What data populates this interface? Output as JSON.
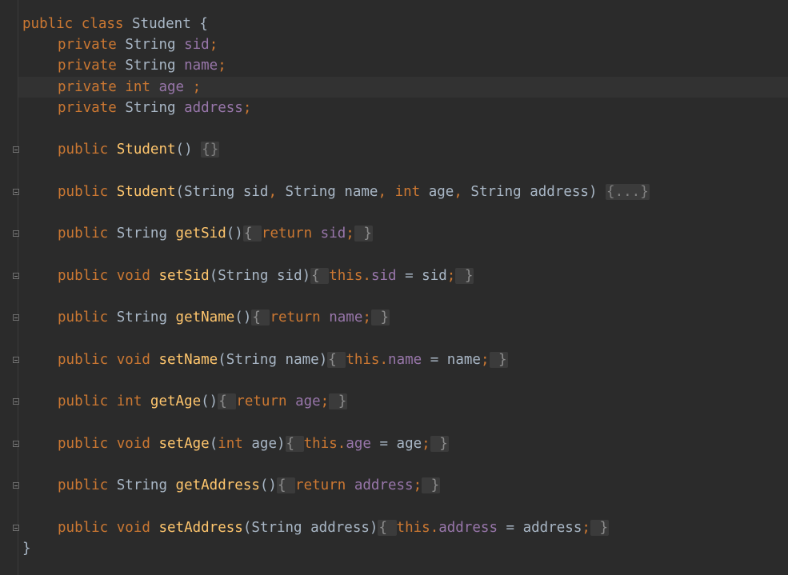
{
  "editor": {
    "lines": {
      "class_decl": {
        "kw_public": "public",
        "kw_class": "class",
        "name": "Student",
        "brace": "{"
      },
      "f_sid": {
        "kw": "private",
        "type": "String",
        "name": "sid",
        "semi": ";"
      },
      "f_name": {
        "kw": "private",
        "type": "String",
        "name": "name",
        "semi": ";"
      },
      "f_age": {
        "kw": "private",
        "type": "int",
        "name": "age",
        "semi": " ;"
      },
      "f_address": {
        "kw": "private",
        "type": "String",
        "name": "address",
        "semi": ";"
      },
      "ctor_default": {
        "kw": "public",
        "name": "Student",
        "parens": "()",
        "fold": "{}"
      },
      "ctor_full": {
        "kw": "public",
        "name": "Student",
        "open": "(",
        "t1": "String",
        "p1": "sid",
        "c1": ",",
        "t2": "String",
        "p2": "name",
        "c2": ",",
        "t3": "int",
        "p3": "age",
        "c3": ",",
        "t4": "String",
        "p4": "address",
        "close": ")",
        "fold": "{...}"
      },
      "get_sid": {
        "kw": "public",
        "type": "String",
        "name": "getSid",
        "parens": "()",
        "ob": "{ ",
        "ret": "return",
        "val": "sid",
        "semi": ";",
        "cb": " }"
      },
      "set_sid": {
        "kw": "public",
        "void": "void",
        "name": "setSid",
        "open": "(",
        "ptype": "String",
        "param": "sid",
        "close": ")",
        "ob": "{ ",
        "this": "this",
        "dot": ".",
        "field": "sid",
        "eq": " = ",
        "val": "sid",
        "semi": ";",
        "cb": " }"
      },
      "get_name": {
        "kw": "public",
        "type": "String",
        "name": "getName",
        "parens": "()",
        "ob": "{ ",
        "ret": "return",
        "val": "name",
        "semi": ";",
        "cb": " }"
      },
      "set_name": {
        "kw": "public",
        "void": "void",
        "name": "setName",
        "open": "(",
        "ptype": "String",
        "param": "name",
        "close": ")",
        "ob": "{ ",
        "this": "this",
        "dot": ".",
        "field": "name",
        "eq": " = ",
        "val": "name",
        "semi": ";",
        "cb": " }"
      },
      "get_age": {
        "kw": "public",
        "type": "int",
        "name": "getAge",
        "parens": "()",
        "ob": "{ ",
        "ret": "return",
        "val": "age",
        "semi": ";",
        "cb": " }"
      },
      "set_age": {
        "kw": "public",
        "void": "void",
        "name": "setAge",
        "open": "(",
        "ptype": "int",
        "param": "age",
        "close": ")",
        "ob": "{ ",
        "this": "this",
        "dot": ".",
        "field": "age",
        "eq": " = ",
        "val": "age",
        "semi": ";",
        "cb": " }"
      },
      "get_address": {
        "kw": "public",
        "type": "String",
        "name": "getAddress",
        "parens": "()",
        "ob": "{ ",
        "ret": "return",
        "val": "address",
        "semi": ";",
        "cb": " }"
      },
      "set_address": {
        "kw": "public",
        "void": "void",
        "name": "setAddress",
        "open": "(",
        "ptype": "String",
        "param": "address",
        "close": ")",
        "ob": "{ ",
        "this": "this",
        "dot": ".",
        "field": "address",
        "eq": " = ",
        "val": "address",
        "semi": ";",
        "cb": " }"
      },
      "class_end": {
        "brace": "}"
      }
    }
  },
  "colors": {
    "background": "#2b2b2b",
    "keyword": "#cc7832",
    "field": "#9876aa",
    "method": "#ffc66d",
    "plain": "#a9b7c6",
    "fold_bg": "#3b3b3b",
    "caret_row": "#323232"
  }
}
